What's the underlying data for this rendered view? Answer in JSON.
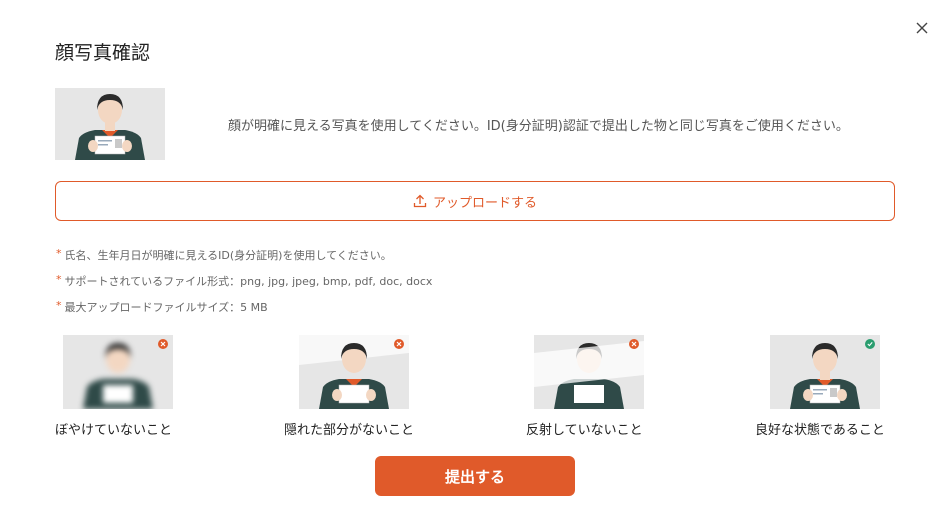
{
  "dialog": {
    "title": "顔写真確認",
    "description": "顔が明確に見える写真を使用してください。ID(身分証明)認証で提出した物と同じ写真をご使用ください。",
    "upload_label": "アップロードする",
    "notes": [
      "氏名、生年月日が明確に見えるID(身分証明)を使用してください。",
      "サポートされているファイル形式：png, jpg, jpeg, bmp, pdf, doc, docx",
      "最大アップロードファイルサイズ：5 MB"
    ],
    "examples": [
      {
        "label": "ぼやけていないこと",
        "status": "bad",
        "icon": "x-icon"
      },
      {
        "label": "隠れた部分がないこと",
        "status": "bad",
        "icon": "x-icon"
      },
      {
        "label": "反射していないこと",
        "status": "bad",
        "icon": "x-icon"
      },
      {
        "label": "良好な状態であること",
        "status": "good",
        "icon": "check-icon"
      }
    ],
    "submit_label": "提出する"
  },
  "colors": {
    "accent": "#e05a2a",
    "good": "#2a9d6f",
    "photo_bg": "#e6e6e6",
    "shirt": "#2f4a48"
  }
}
